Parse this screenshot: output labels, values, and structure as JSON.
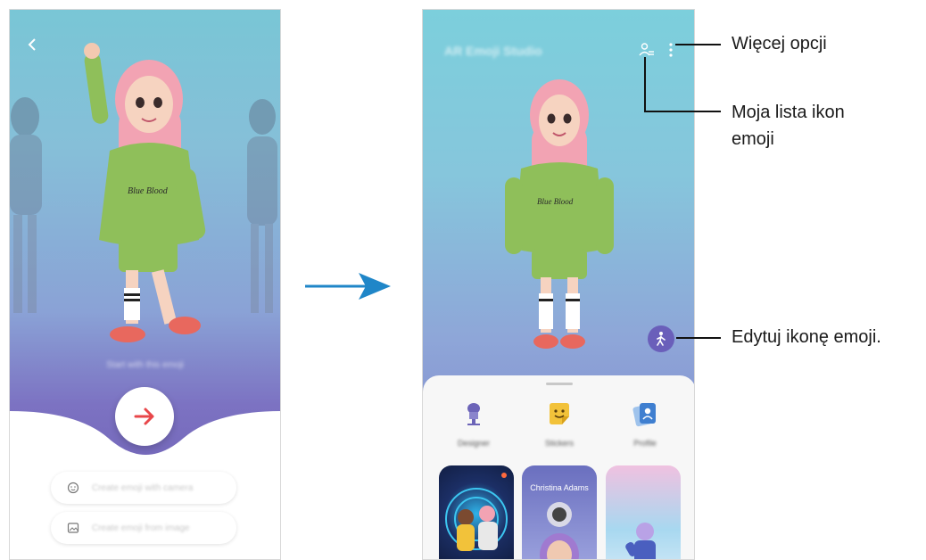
{
  "left_screen": {
    "back_icon": "chevron-left-icon",
    "start_text": "Start with this emoji",
    "next_icon": "arrow-right-icon",
    "buttons": [
      {
        "label": "Create emoji with camera",
        "icon": "face-icon"
      },
      {
        "label": "Create emoji from image",
        "icon": "image-icon"
      }
    ]
  },
  "transition_icon": "arrow-right-icon",
  "right_screen": {
    "title": "AR Emoji Studio",
    "my_emoji_list_icon": "person-list-icon",
    "more_options_icon": "more-vertical-icon",
    "edit_icon": "walking-person-icon",
    "categories": [
      {
        "label": "Designer",
        "icon": "designer-icon"
      },
      {
        "label": "Stickers",
        "icon": "sticker-icon"
      },
      {
        "label": "Profile",
        "icon": "profile-card-icon"
      }
    ],
    "cards": [
      {
        "title": ""
      },
      {
        "title": "Christina Adams"
      },
      {
        "title": ""
      }
    ]
  },
  "callouts": {
    "more_options": "Więcej opcji",
    "my_emoji_list": "Moja lista ikon\nemoji",
    "edit_emoji": "Edytuj ikonę emoji."
  },
  "colors": {
    "arrow": "#1f86c8",
    "next_arrow": "#e8474a",
    "accent_purple": "#6a5fba"
  }
}
